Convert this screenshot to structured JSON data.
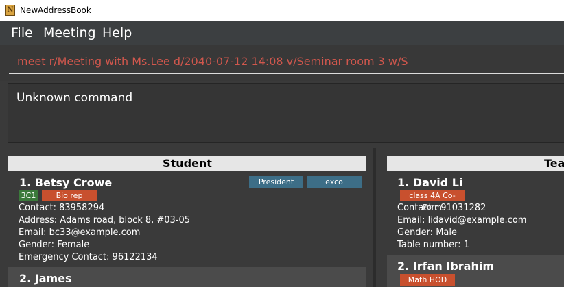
{
  "window": {
    "title": "NewAddressBook"
  },
  "menu": {
    "file": "File",
    "meeting": "Meeting",
    "help": "Help"
  },
  "command": {
    "value": "meet r/Meeting with Ms.Lee d/2040-07-12 14:08 v/Seminar room 3 w/S"
  },
  "result": {
    "text": "Unknown command"
  },
  "students": {
    "header": "Student",
    "items": [
      {
        "name": "1.  Betsy Crowe",
        "roles": [
          "President",
          "exco"
        ],
        "tags": [
          {
            "label": "3C1",
            "color": "#3b7a3b"
          },
          {
            "label": "Bio rep",
            "color": "#c8502e"
          }
        ],
        "contact": "Contact: 83958294",
        "address": "Address: Adams road, block 8, #03-05",
        "email": "Email: bc33@example.com",
        "gender": "Gender: Female",
        "emergency": "Emergency Contact: 96122134"
      },
      {
        "name": "2.  James"
      }
    ]
  },
  "teachers": {
    "header": "Teacher",
    "items": [
      {
        "name": "1. David Li",
        "tags": [
          {
            "label": "class 4A Co-Form",
            "color": "#c8502e"
          }
        ],
        "contact": "Contact : 91031282",
        "email": "Email: lidavid@example.com",
        "gender": "Gender: Male",
        "table": "Table number: 1"
      },
      {
        "name": "2. Irfan Ibrahim",
        "tags": [
          {
            "label": "Math HOD",
            "color": "#c8502e"
          }
        ]
      }
    ]
  },
  "colors": {
    "role_badge": "#3d6e87",
    "card_odd": "#3a3a3a",
    "card_even": "#4b4b4b",
    "command_text": "#d0574d"
  }
}
